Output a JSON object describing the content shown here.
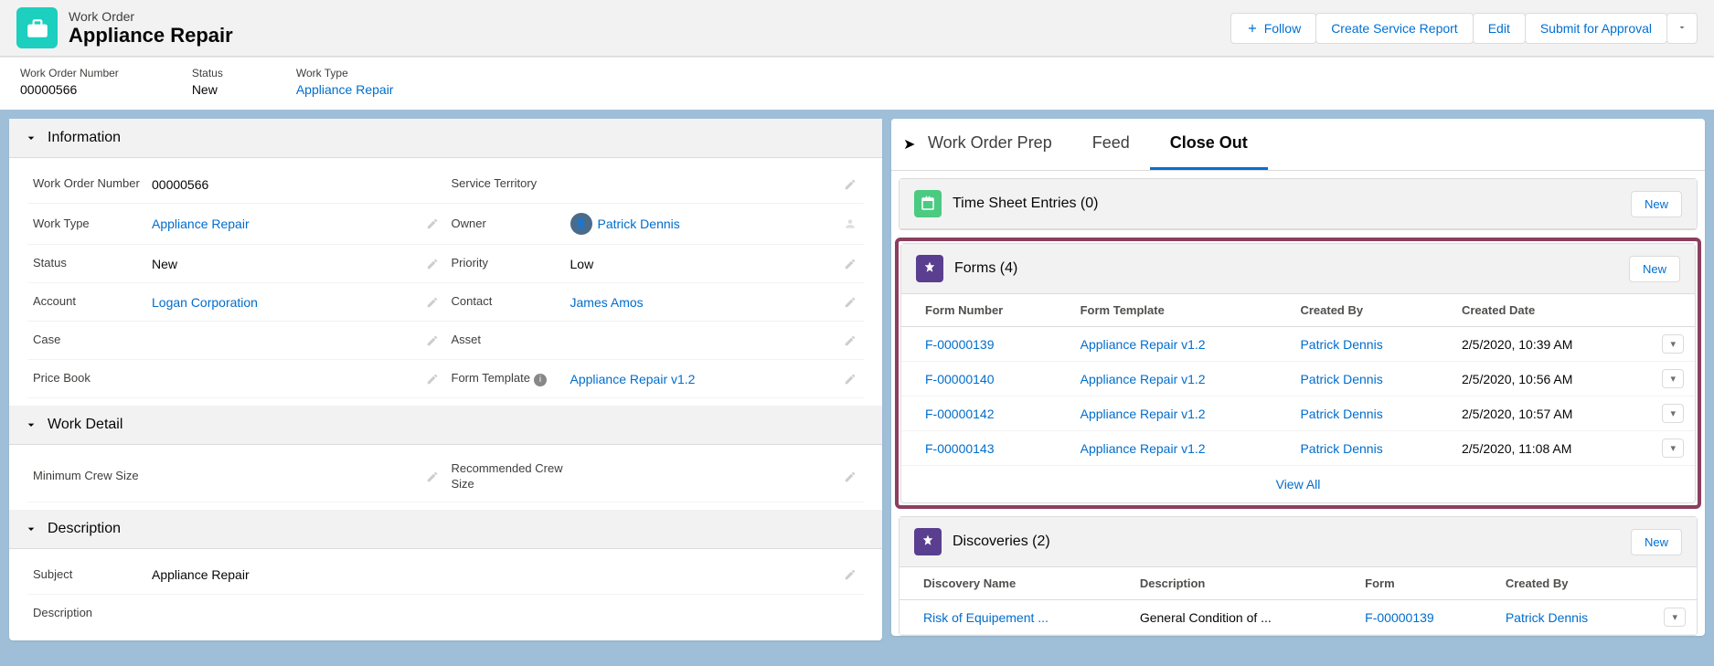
{
  "header": {
    "object_label": "Work Order",
    "record_name": "Appliance Repair",
    "actions": {
      "follow": "Follow",
      "create_service_report": "Create Service Report",
      "edit": "Edit",
      "submit_approval": "Submit for Approval"
    }
  },
  "highlights": {
    "wo_num_label": "Work Order Number",
    "wo_num": "00000566",
    "status_label": "Status",
    "status": "New",
    "work_type_label": "Work Type",
    "work_type": "Appliance Repair"
  },
  "sections": {
    "information": "Information",
    "work_detail": "Work Detail",
    "description": "Description"
  },
  "info": {
    "wo_num_label": "Work Order Number",
    "wo_num": "00000566",
    "service_territory_label": "Service Territory",
    "work_type_label": "Work Type",
    "work_type": "Appliance Repair",
    "owner_label": "Owner",
    "owner": "Patrick Dennis",
    "status_label": "Status",
    "status": "New",
    "priority_label": "Priority",
    "priority": "Low",
    "account_label": "Account",
    "account": "Logan Corporation",
    "contact_label": "Contact",
    "contact": "James Amos",
    "case_label": "Case",
    "asset_label": "Asset",
    "price_book_label": "Price Book",
    "form_template_label": "Form Template",
    "form_template": "Appliance Repair v1.2"
  },
  "work_detail": {
    "min_crew_label": "Minimum Crew Size",
    "rec_crew_label": "Recommended Crew Size"
  },
  "desc": {
    "subject_label": "Subject",
    "subject": "Appliance Repair",
    "description_label": "Description"
  },
  "tabs": {
    "prep": "Work Order Prep",
    "feed": "Feed",
    "close_out": "Close Out"
  },
  "related": {
    "time_sheet": {
      "title": "Time Sheet Entries (0)",
      "new": "New"
    },
    "forms": {
      "title": "Forms (4)",
      "new": "New",
      "cols": {
        "num": "Form Number",
        "template": "Form Template",
        "by": "Created By",
        "date": "Created Date"
      },
      "rows": [
        {
          "num": "F-00000139",
          "template": "Appliance Repair v1.2",
          "by": "Patrick Dennis",
          "date": "2/5/2020, 10:39 AM"
        },
        {
          "num": "F-00000140",
          "template": "Appliance Repair v1.2",
          "by": "Patrick Dennis",
          "date": "2/5/2020, 10:56 AM"
        },
        {
          "num": "F-00000142",
          "template": "Appliance Repair v1.2",
          "by": "Patrick Dennis",
          "date": "2/5/2020, 10:57 AM"
        },
        {
          "num": "F-00000143",
          "template": "Appliance Repair v1.2",
          "by": "Patrick Dennis",
          "date": "2/5/2020, 11:08 AM"
        }
      ],
      "view_all": "View All"
    },
    "discoveries": {
      "title": "Discoveries (2)",
      "new": "New",
      "cols": {
        "name": "Discovery Name",
        "desc": "Description",
        "form": "Form",
        "by": "Created By"
      },
      "rows": [
        {
          "name": "Risk of Equipement ...",
          "desc": "General Condition of ...",
          "form": "F-00000139",
          "by": "Patrick Dennis"
        }
      ]
    }
  }
}
